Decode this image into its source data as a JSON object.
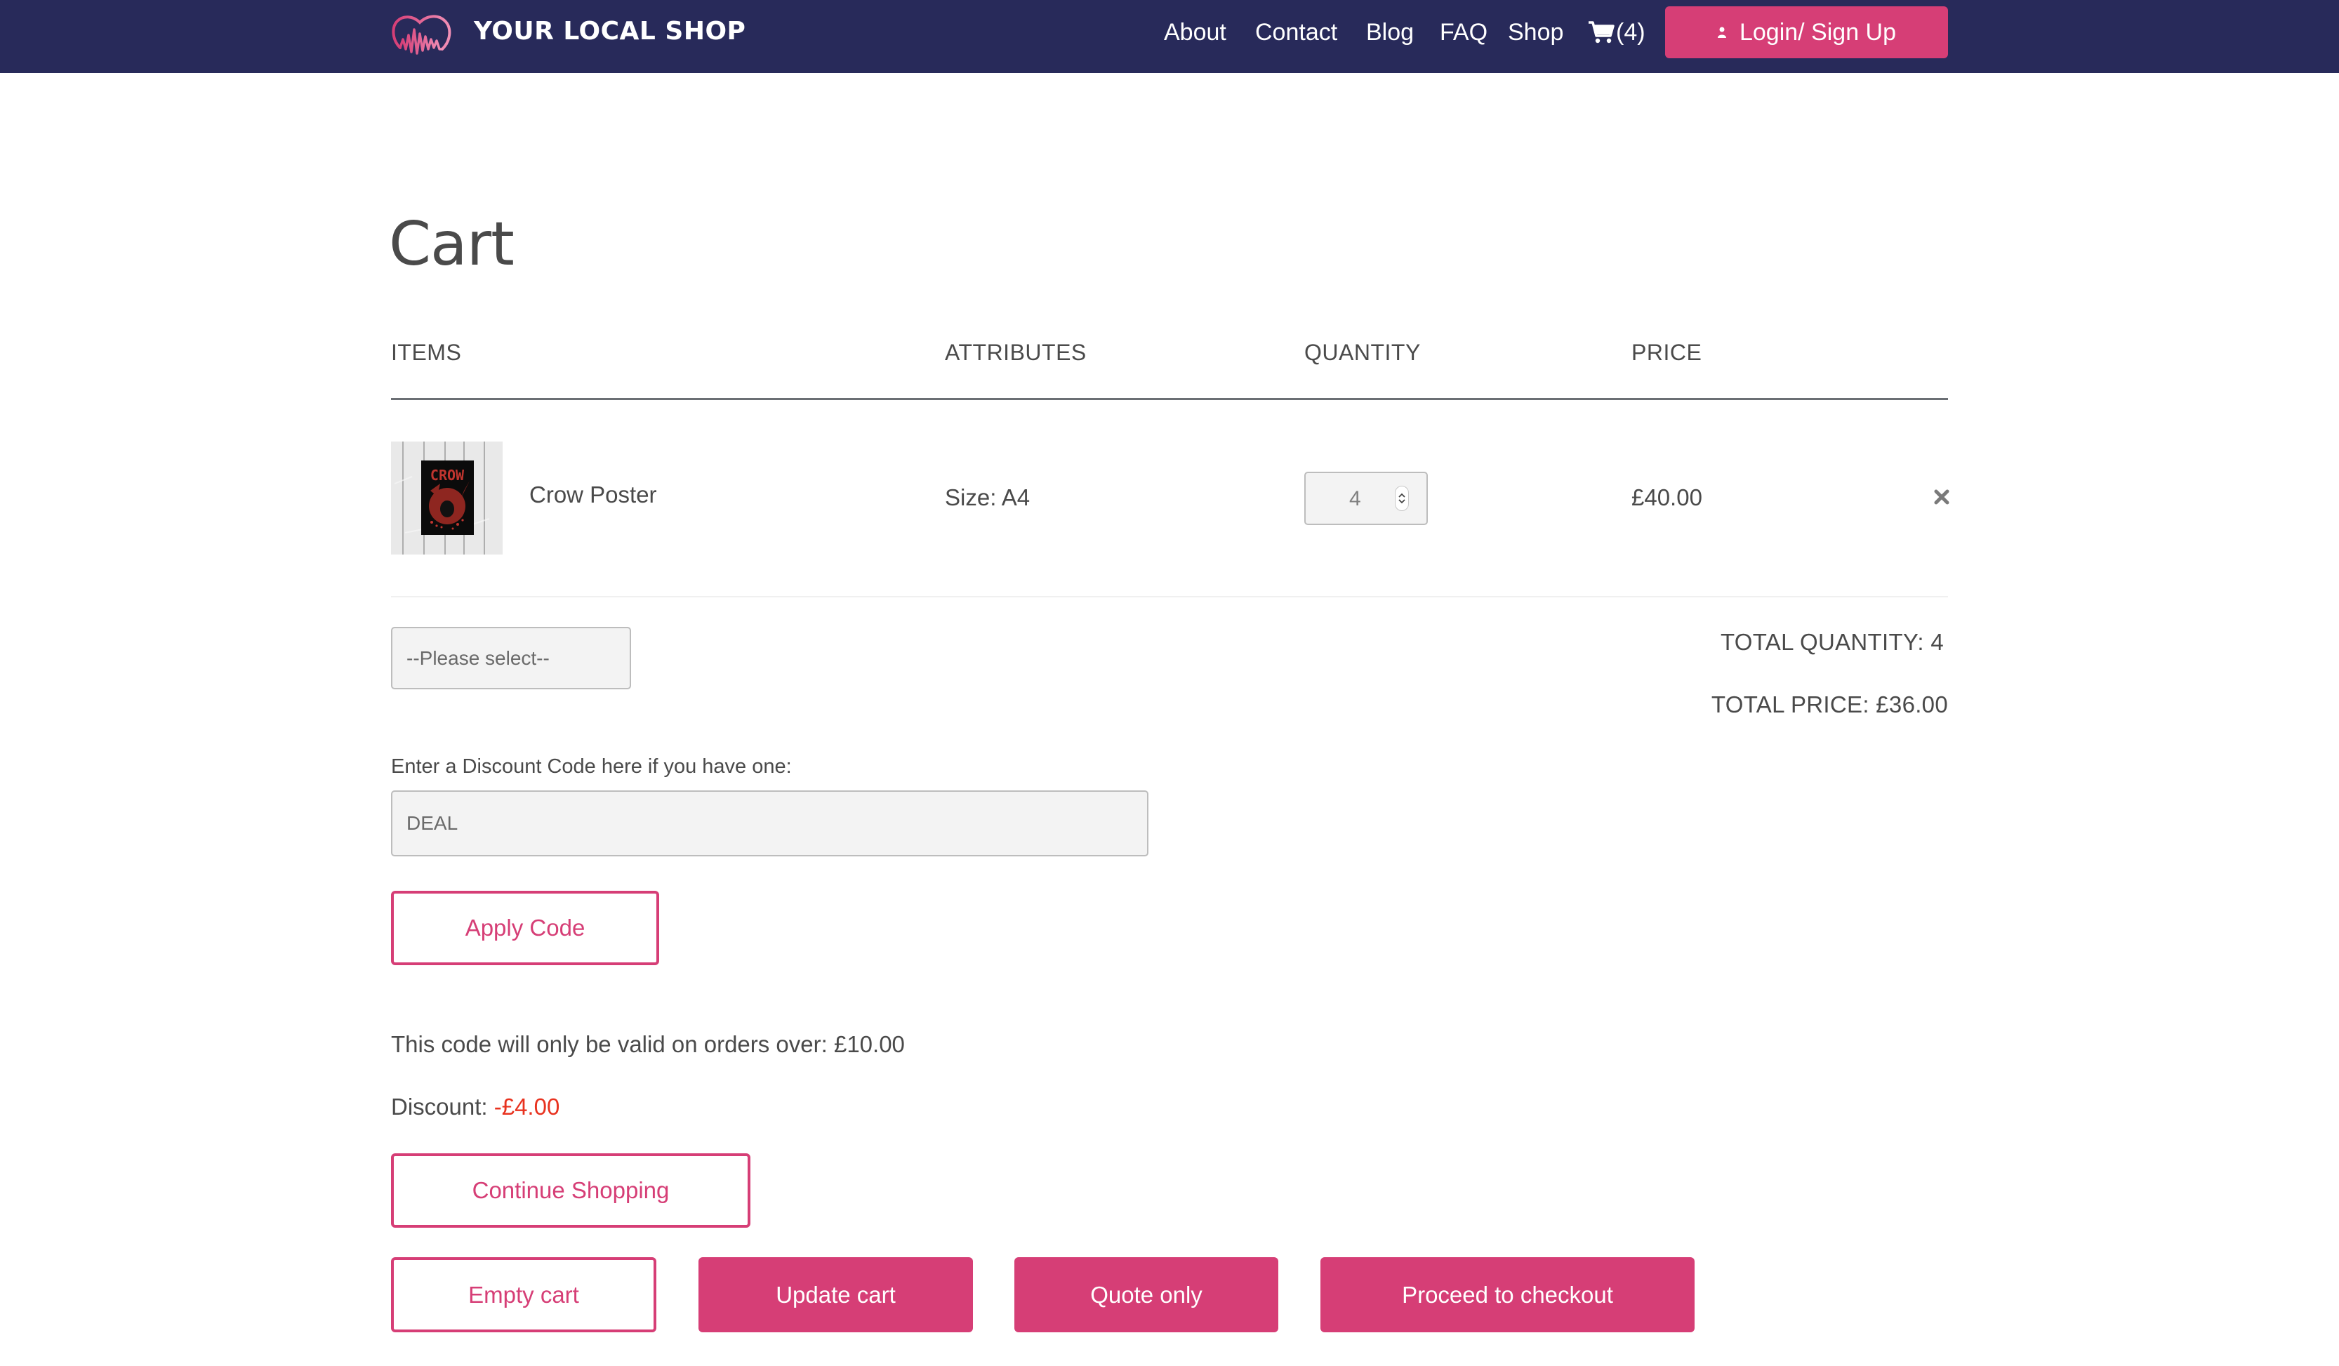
{
  "header": {
    "brand": "YOUR LOCAL SHOP",
    "nav": [
      {
        "label": "About"
      },
      {
        "label": "Contact"
      },
      {
        "label": "Blog"
      },
      {
        "label": "FAQ"
      },
      {
        "label": "Shop"
      }
    ],
    "cart_count": "(4)",
    "login_label": "Login/ Sign Up"
  },
  "page": {
    "title": "Cart"
  },
  "table": {
    "headers": [
      "ITEMS",
      "ATTRIBUTES",
      "QUANTITY",
      "PRICE"
    ],
    "rows": [
      {
        "name": "Crow Poster",
        "image_label": "CROW",
        "attributes": "Size: A4",
        "quantity": "4",
        "price": "£40.00"
      }
    ]
  },
  "select": {
    "value": "--Please select--"
  },
  "totals": {
    "quantity": "TOTAL QUANTITY: 4",
    "price": "TOTAL PRICE: £36.00"
  },
  "discount": {
    "label": "Enter a Discount Code here if you have one:",
    "code_value": "DEAL",
    "apply_label": "Apply Code",
    "valid_text": "This code will only be valid on orders over: £10.00",
    "discount_label": "Discount: ",
    "discount_value": "-£4.00"
  },
  "actions": {
    "continue": "Continue Shopping",
    "empty": "Empty cart",
    "update": "Update cart",
    "quote": "Quote only",
    "checkout": "Proceed to checkout"
  },
  "colors": {
    "header_bg": "#282a5a",
    "accent": "#d63e76",
    "discount_red": "#e8321f",
    "text": "#4a4a4a"
  }
}
